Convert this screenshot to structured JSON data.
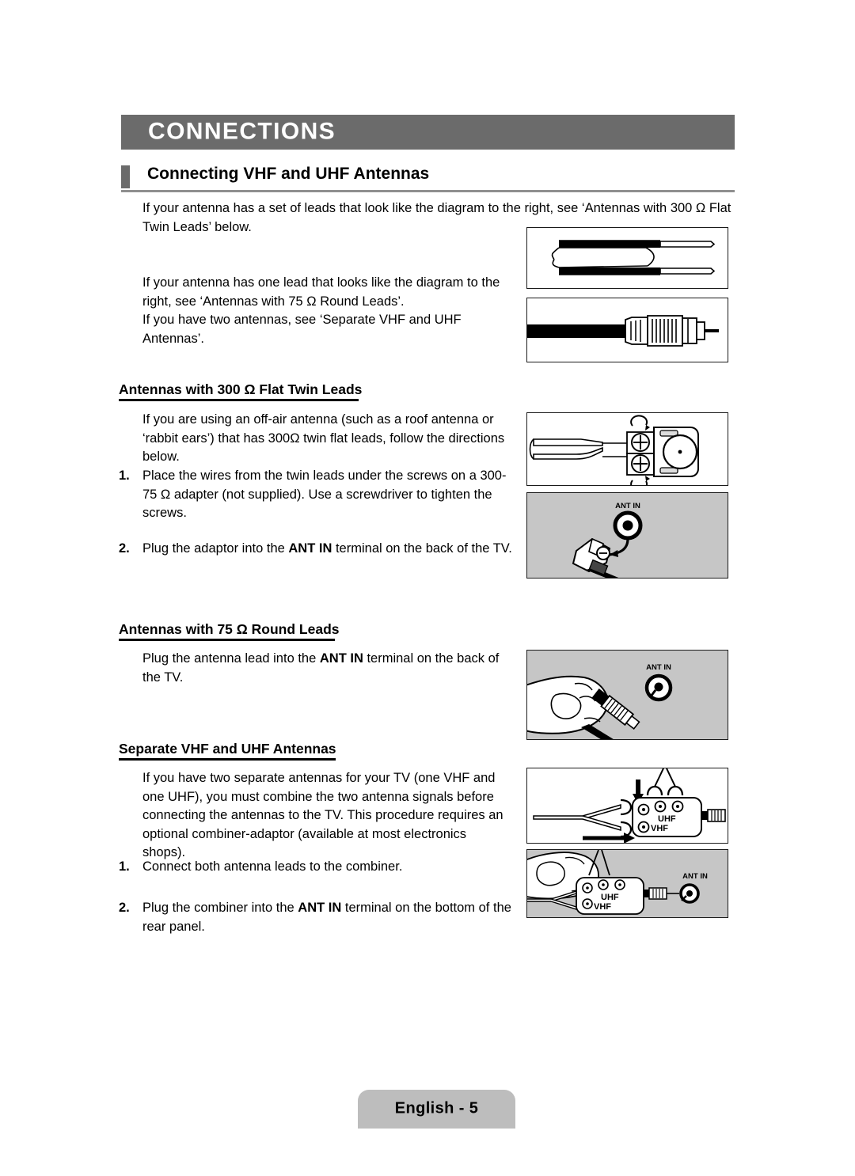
{
  "chapter": {
    "banner_title": "CONNECTIONS"
  },
  "section": {
    "heading": "Connecting VHF and UHF Antennas"
  },
  "intro": {
    "para1": "If your antenna has a set of leads that look like the diagram to the right, see ‘Antennas with 300 Ω Flat Twin Leads’ below.",
    "para2": "If your antenna has one lead that looks like the diagram to the right, see ‘Antennas with 75 Ω Round Leads’.",
    "para3": "If you have two antennas, see ‘Separate VHF and UHF Antennas’."
  },
  "flat_twin": {
    "heading": "Antennas with 300 Ω Flat Twin Leads",
    "intro": "If you are using an off-air antenna (such as a roof antenna or ‘rabbit ears’) that has 300Ω twin flat leads, follow the directions below.",
    "steps": [
      {
        "num": "1.",
        "text_pre": "Place the wires from the twin leads under the screws on a 300-75 Ω adapter (not supplied). Use a screwdriver to tighten the screws.",
        "bold": "",
        "text_post": ""
      },
      {
        "num": "2.",
        "text_pre": "Plug the adaptor into the ",
        "bold": "ANT IN",
        "text_post": " terminal on the back of the TV."
      }
    ]
  },
  "round_leads": {
    "heading": "Antennas with 75 Ω Round Leads",
    "body_pre": "Plug the antenna lead into the ",
    "body_bold": "ANT IN",
    "body_post": " terminal on the back of the TV."
  },
  "separate": {
    "heading": "Separate VHF and UHF Antennas",
    "intro": "If you have two separate antennas for your TV (one VHF and one UHF), you must combine the two antenna signals before connecting the antennas to the TV. This procedure requires an optional combiner-adaptor (available at most electronics shops).",
    "steps": [
      {
        "num": "1.",
        "text_pre": "Connect both antenna leads to the combiner.",
        "bold": "",
        "text_post": ""
      },
      {
        "num": "2.",
        "text_pre": "Plug the combiner into the ",
        "bold": "ANT IN",
        "text_post": " terminal on the bottom of the rear panel."
      }
    ]
  },
  "figures": {
    "flat_twin_lead": {
      "name": "300 ohm flat twin lead cable"
    },
    "round_lead": {
      "name": "75 ohm round lead cable with connector"
    },
    "adapter_screws": {
      "name": "300-75 ohm adapter with screws"
    },
    "ant_in_back": {
      "name": "ANT IN terminal on back of TV",
      "label": "ANT IN"
    },
    "ant_in_hand": {
      "name": "hand plugging lead into ANT IN",
      "label": "ANT IN"
    },
    "combiner": {
      "name": "combiner adaptor wiring",
      "uhf": "UHF",
      "vhf": "VHF"
    },
    "combiner_ant_in": {
      "name": "combiner plugged into ANT IN",
      "uhf": "UHF",
      "vhf": "VHF",
      "label": "ANT IN"
    }
  },
  "footer": {
    "page_label": "English - 5"
  },
  "colors": {
    "banner_gray": "#6b6b6b",
    "rule_gray": "#8f8f8f",
    "panel_gray": "#c6c6c6",
    "badge_gray": "#bdbdbd",
    "ink": "#000000"
  }
}
